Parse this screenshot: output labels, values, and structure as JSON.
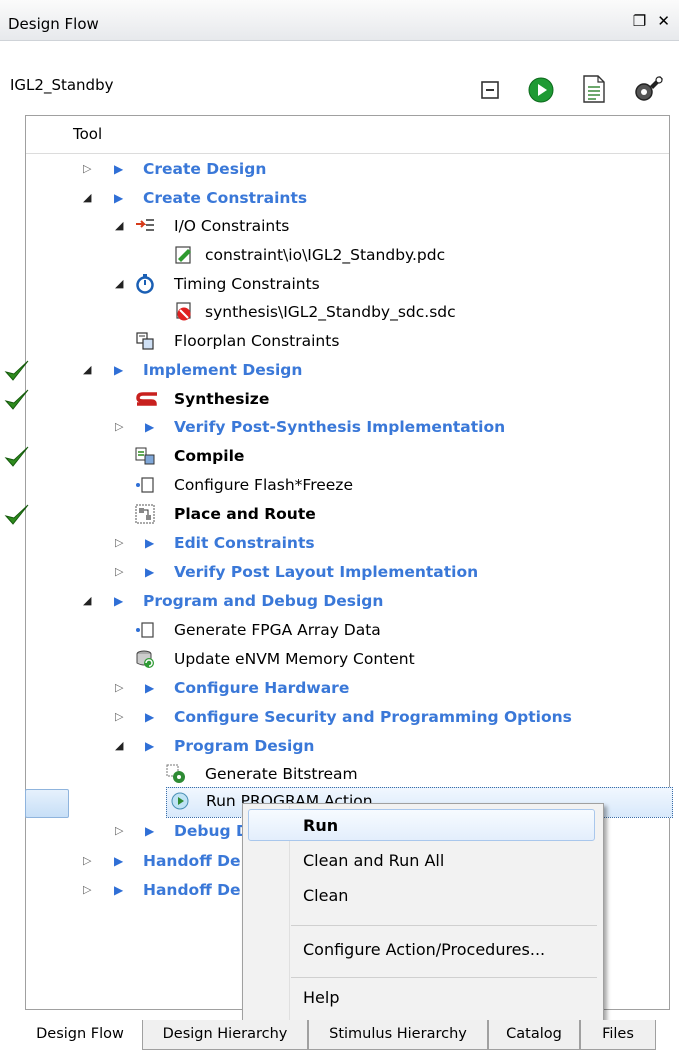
{
  "panel": {
    "title": "Design Flow",
    "window_controls": "❐ ✕"
  },
  "project_name": "IGL2_Standby",
  "toolbar": {
    "icons": [
      "collapse-icon",
      "run-icon",
      "report-icon",
      "options-icon"
    ]
  },
  "tree": {
    "column_header": "Tool",
    "rows": [
      {
        "label": "Create Design"
      },
      {
        "label": "Create Constraints"
      },
      {
        "label": "I/O Constraints"
      },
      {
        "label": "constraint\\io\\IGL2_Standby.pdc"
      },
      {
        "label": "Timing Constraints"
      },
      {
        "label": "synthesis\\IGL2_Standby_sdc.sdc"
      },
      {
        "label": "Floorplan Constraints"
      },
      {
        "label": "Implement Design"
      },
      {
        "label": "Synthesize"
      },
      {
        "label": "Verify Post-Synthesis Implementation"
      },
      {
        "label": "Compile"
      },
      {
        "label": "Configure Flash*Freeze"
      },
      {
        "label": "Place and Route"
      },
      {
        "label": "Edit Constraints"
      },
      {
        "label": "Verify Post Layout Implementation"
      },
      {
        "label": "Program and Debug Design"
      },
      {
        "label": "Generate FPGA Array Data"
      },
      {
        "label": "Update eNVM Memory Content"
      },
      {
        "label": "Configure Hardware"
      },
      {
        "label": "Configure Security and Programming Options"
      },
      {
        "label": "Program Design"
      },
      {
        "label": "Generate Bitstream"
      },
      {
        "label": "Run PROGRAM Action"
      },
      {
        "label": "Debug D"
      },
      {
        "label": "Handoff De"
      },
      {
        "label": "Handoff De"
      }
    ]
  },
  "context_menu": {
    "items": [
      "Run",
      "Clean and Run All",
      "Clean",
      "Configure Action/Procedures...",
      "Help"
    ]
  },
  "tabs": [
    "Design Flow",
    "Design Hierarchy",
    "Stimulus Hierarchy",
    "Catalog",
    "Files"
  ],
  "colors": {
    "link": "#3a78d8",
    "check": "#2e8b1e",
    "selection": "#d8e9fb"
  }
}
